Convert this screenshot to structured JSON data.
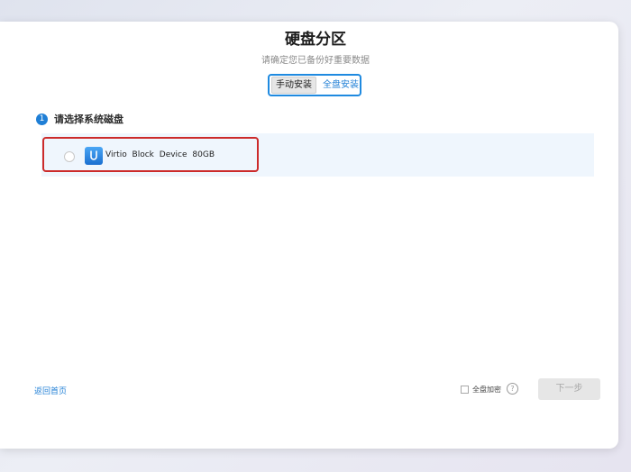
{
  "header": {
    "title": "硬盘分区",
    "subtitle": "请确定您已备份好重要数据"
  },
  "mode_toggle": {
    "manual_label": "手动安装",
    "full_label": "全盘安装",
    "selected": "手动安装"
  },
  "step": {
    "number": "1",
    "label": "请选择系统磁盘"
  },
  "disks": [
    {
      "name": "Virtio Block Device 80GB",
      "icon": "disk-drive-icon",
      "selected": false
    }
  ],
  "footer": {
    "back_label": "返回首页",
    "encrypt_label": "全盘加密",
    "encrypt_checked": false,
    "help_icon": "question-circle-icon",
    "next_label": "下一步",
    "next_enabled": false
  },
  "colors": {
    "accent": "#1f7fd6",
    "highlight_border": "#cc2b2b",
    "row_bg": "#eff6fd"
  }
}
